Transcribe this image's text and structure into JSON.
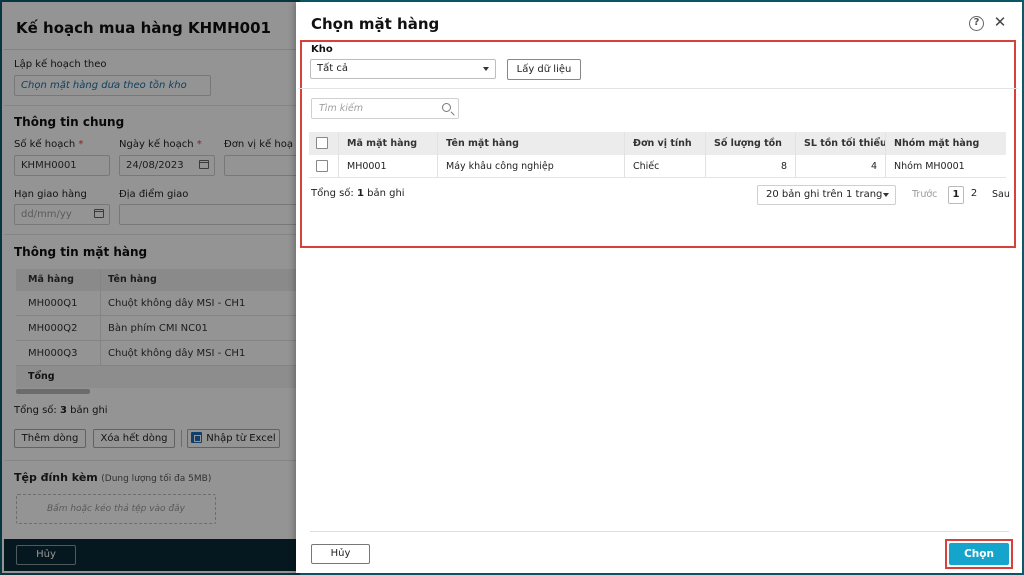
{
  "background": {
    "title": "Kế hoạch mua hàng KHMH001",
    "plan_from_label": "Lập kế hoạch theo",
    "plan_from_value": "Chọn mặt hàng dưa theo tồn kho",
    "general_section": "Thông tin chung",
    "plan_no_label": "Số kế hoạch",
    "plan_no_value": "KHMH0001",
    "plan_date_label": "Ngày kế hoạch",
    "plan_date_value": "24/08/2023",
    "unit_label": "Đơn vị kế hoạ",
    "due_label": "Hạn giao hàng",
    "due_placeholder": "dd/mm/yy",
    "place_label": "Địa điểm giao",
    "required_mark": "*",
    "items_section": "Thông tin mặt hàng",
    "items_headers": [
      "Mã hàng",
      "Tên hàng"
    ],
    "items_rows": [
      {
        "code": "MH000Q1",
        "name": "Chuột không dây MSI - CH1"
      },
      {
        "code": "MH000Q2",
        "name": "Bàn phím CMI NC01"
      },
      {
        "code": "MH000Q3",
        "name": "Chuột không dây MSI - CH1"
      }
    ],
    "items_total_label": "Tổng",
    "count_prefix": "Tổng số: ",
    "count_bold": "3",
    "count_suffix": " bản ghi",
    "add_row_label": "Thêm dòng",
    "delete_all_label": "Xóa hết dòng",
    "import_excel_label": "Nhập từ Excel",
    "attach_label": "Tệp đính kèm",
    "attach_hint": "(Dung lượng tối đa 5MB)",
    "upload_hint": "Bấm hoặc kéo thả tệp vào đây",
    "cancel_label": "Hủy"
  },
  "modal": {
    "title": "Chọn mặt hàng",
    "help_icon": "?",
    "close_icon": "✕",
    "warehouse_label": "Kho",
    "warehouse_value": "Tất cả",
    "fetch_label": "Lấy dữ liệu",
    "search_placeholder": "Tìm kiếm",
    "table": {
      "headers": {
        "code": "Mã mặt hàng",
        "name": "Tên mặt hàng",
        "unit": "Đơn vị tính",
        "qty": "Số lượng tồn",
        "min": "SL tồn tối thiểu",
        "group": "Nhóm mặt hàng"
      },
      "rows": [
        {
          "code": "MH0001",
          "name": "Máy khâu công nghiệp",
          "unit": "Chiếc",
          "qty": "8",
          "min": "4",
          "group": "Nhóm MH0001"
        }
      ]
    },
    "summary_prefix": "Tổng số: ",
    "summary_bold": "1",
    "summary_suffix": " bản ghi",
    "page_size_label": "20 bản ghi trên 1 trang",
    "prev_label": "Trước",
    "pages": [
      "1",
      "2"
    ],
    "next_label": "Sau",
    "cancel_label": "Hủy",
    "choose_label": "Chọn"
  },
  "colors": {
    "primary": "#15a5cc",
    "highlight": "#d9403c",
    "required": "#e53935",
    "frame": "#0b5d6e"
  }
}
